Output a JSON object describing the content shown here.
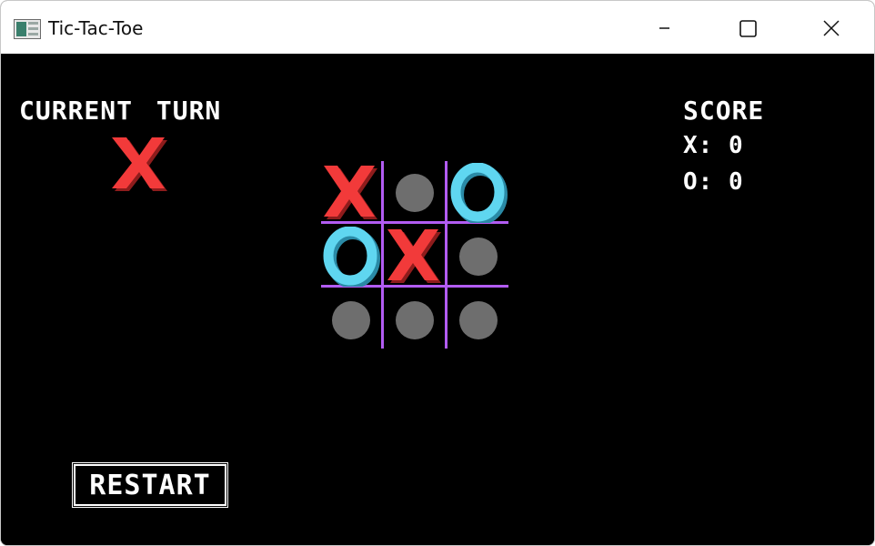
{
  "window": {
    "title": "Tic-Tac-Toe",
    "icon": "app-window-icon",
    "controls": [
      "minimize-icon",
      "maximize-icon",
      "close-icon"
    ]
  },
  "turn": {
    "label": "CURRENT TURN",
    "player": "X"
  },
  "score": {
    "label": "SCORE",
    "x_line": "X: 0",
    "o_line": "O: 0"
  },
  "board": {
    "cells": [
      "X",
      "",
      "O",
      "O",
      "X",
      "",
      "",
      "",
      ""
    ],
    "empty_marker": "gray-dot"
  },
  "restart_label": "RESTART",
  "colors": {
    "background": "#000000",
    "grid": "#b25cf2",
    "x_mark": "#f23a3a",
    "o_mark": "#5fd6f0",
    "empty_dot": "#6e6e6e",
    "text": "#ffffff"
  }
}
